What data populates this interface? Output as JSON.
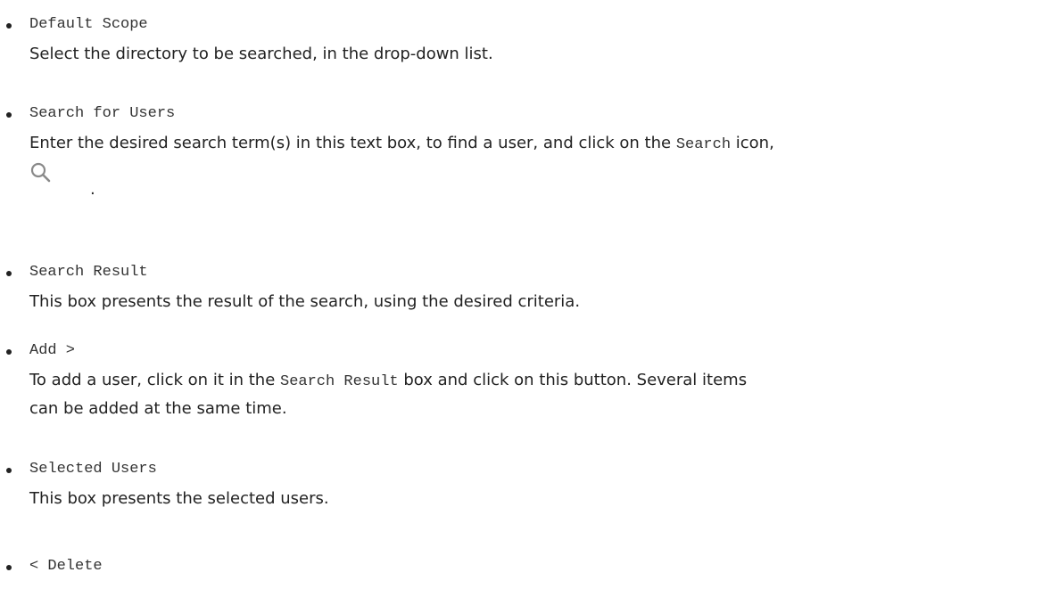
{
  "items": [
    {
      "term": "Default Scope",
      "desc": "Select the directory to be searched, in the drop-down list."
    },
    {
      "term": "Search for Users",
      "desc_before": "Enter the desired search term(s) in this text box, to find a user, and click on the ",
      "desc_code": "Search",
      "desc_after": " icon,",
      "icon": "search-icon",
      "period": "."
    },
    {
      "term": "Search Result",
      "desc": "This box presents the result of the search, using the desired criteria."
    },
    {
      "term": "Add >",
      "desc_before": "To add a user, click on it in the ",
      "desc_code": "Search Result",
      "desc_after": " box and click on this button. Several items",
      "desc_line2": "can be added at the same time."
    },
    {
      "term": "Selected Users",
      "desc": "This box presents the selected users."
    },
    {
      "term": "< Delete"
    }
  ],
  "colors": {
    "text": "#222222",
    "icon": "#8a8a8a"
  }
}
